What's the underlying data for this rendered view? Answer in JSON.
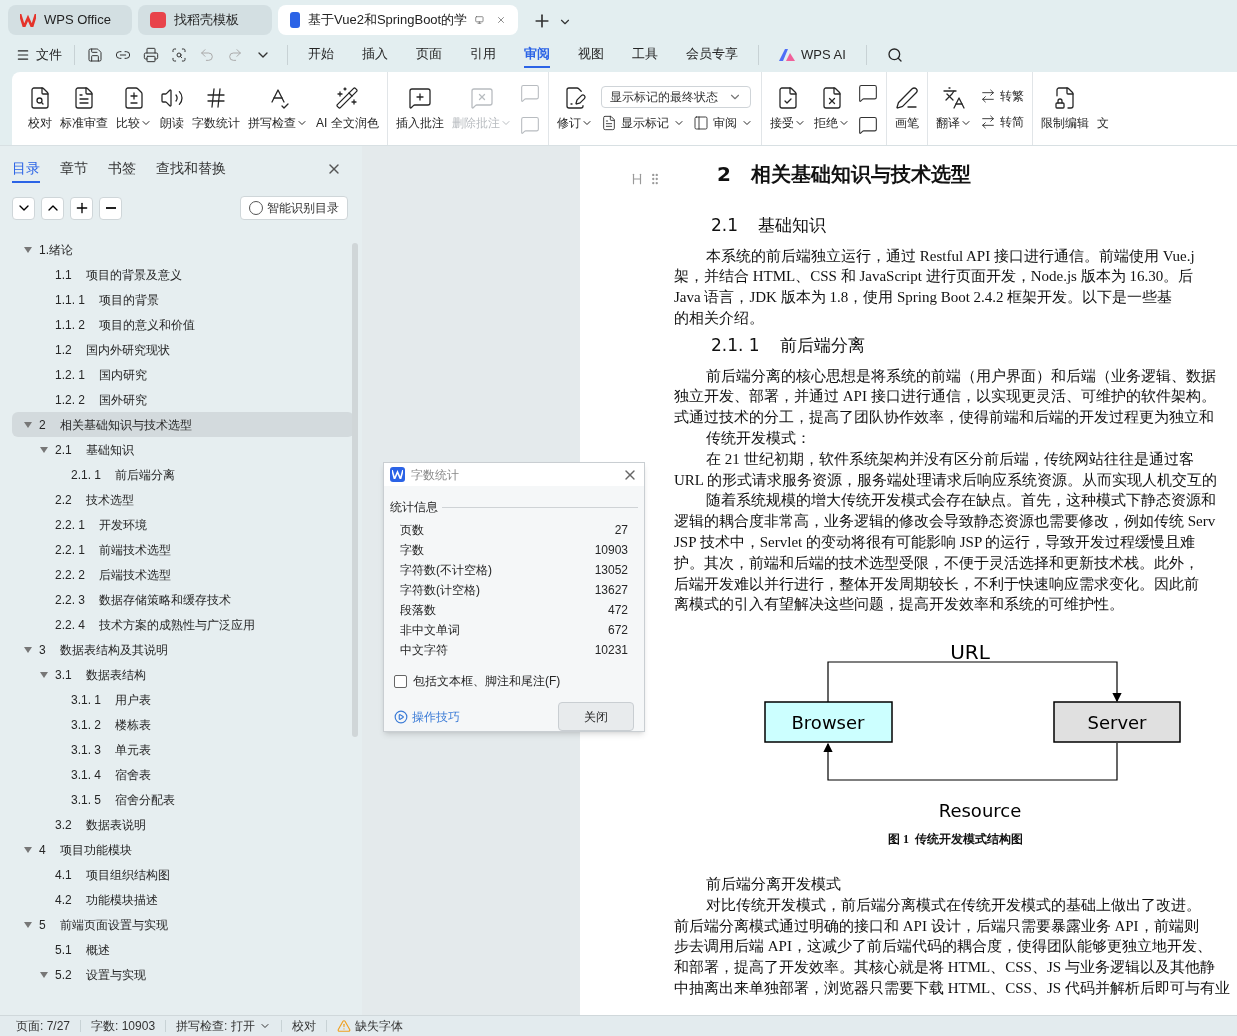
{
  "tabs": [
    {
      "label": "WPS Office",
      "selected": false
    },
    {
      "label": "找稻壳模板",
      "selected": false
    },
    {
      "label": "基于Vue2和SpringBoot的学",
      "selected": true
    }
  ],
  "menu": {
    "file": "文件",
    "tabs": [
      {
        "label": "开始",
        "selected": false
      },
      {
        "label": "插入",
        "selected": false
      },
      {
        "label": "页面",
        "selected": false
      },
      {
        "label": "引用",
        "selected": false
      },
      {
        "label": "审阅",
        "selected": true
      },
      {
        "label": "视图",
        "selected": false
      },
      {
        "label": "工具",
        "selected": false
      },
      {
        "label": "会员专享",
        "selected": false
      }
    ],
    "ai": "WPS AI"
  },
  "ribbon": [
    [
      {
        "kind": "large",
        "label": "校对",
        "caret": false,
        "disabled": false
      },
      {
        "kind": "large",
        "label": "标准审查",
        "caret": false,
        "disabled": false
      },
      {
        "kind": "large",
        "label": "比较",
        "caret": true,
        "disabled": false
      },
      {
        "kind": "large",
        "label": "朗读",
        "caret": false,
        "disabled": false
      },
      {
        "kind": "large",
        "label": "字数统计",
        "caret": false,
        "disabled": false
      },
      {
        "kind": "large",
        "label": "拼写检查",
        "caret": true,
        "disabled": false
      },
      {
        "kind": "large",
        "label": "AI 全文润色",
        "caret": false,
        "disabled": false
      }
    ],
    [
      {
        "kind": "large",
        "label": "插入批注",
        "caret": false,
        "disabled": false
      },
      {
        "kind": "large",
        "label": "删除批注",
        "caret": true,
        "disabled": true
      },
      {
        "kind": "icons",
        "disabled": true
      }
    ],
    [
      {
        "kind": "large",
        "label": "修订",
        "caret": true,
        "disabled": false
      },
      {
        "kind": "stack",
        "select": "显示标记的最终状态",
        "buttons": [
          {
            "label": "显示标记",
            "caret": true
          },
          {
            "label": "审阅",
            "caret": true
          }
        ]
      }
    ],
    [
      {
        "kind": "large",
        "label": "接受",
        "caret": true,
        "disabled": false
      },
      {
        "kind": "large",
        "label": "拒绝",
        "caret": true,
        "disabled": false
      },
      {
        "kind": "icons",
        "disabled": false
      }
    ],
    [
      {
        "kind": "large",
        "label": "画笔",
        "caret": false,
        "disabled": false
      }
    ],
    [
      {
        "kind": "large",
        "label": "翻译",
        "caret": true,
        "disabled": false
      },
      {
        "kind": "stack",
        "buttons": [
          {
            "label": "转繁",
            "caret": false
          },
          {
            "label": "转简",
            "caret": false
          }
        ]
      }
    ],
    [
      {
        "kind": "large",
        "label": "限制编辑",
        "caret": false,
        "disabled": false
      },
      {
        "kind": "large",
        "label": "文",
        "caret": false,
        "disabled": false
      }
    ]
  ],
  "nav": {
    "tabs": [
      {
        "label": "目录",
        "selected": true
      },
      {
        "label": "章节",
        "selected": false
      },
      {
        "label": "书签",
        "selected": false
      },
      {
        "label": "查找和替换",
        "selected": false
      }
    ],
    "smart_button": "智能识别目录",
    "tree": [
      {
        "title": "1.绪论",
        "expanded": true,
        "selected": false,
        "children": [
          {
            "num": "1.1",
            "title": "项目的背景及意义",
            "selected": false
          },
          {
            "num": "1.1. 1",
            "title": "项目的背景",
            "selected": false
          },
          {
            "num": "1.1. 2",
            "title": "项目的意义和价值",
            "selected": false
          },
          {
            "num": "1.2",
            "title": "国内外研究现状",
            "selected": false
          },
          {
            "num": "1.2. 1",
            "title": "国内研究",
            "selected": false
          },
          {
            "num": "1.2. 2",
            "title": "国外研究",
            "selected": false
          }
        ]
      },
      {
        "num": "2",
        "title": "相关基础知识与技术选型",
        "expanded": true,
        "selected": true,
        "children": [
          {
            "num": "2.1",
            "title": "基础知识",
            "expanded": true,
            "selected": false,
            "children": [
              {
                "num": "2.1. 1",
                "title": "前后端分离",
                "selected": false
              }
            ]
          },
          {
            "num": "2.2",
            "title": "技术选型",
            "selected": false
          },
          {
            "num": "2.2. 1",
            "title": "开发环境",
            "selected": false
          },
          {
            "num": "2.2. 1",
            "title": "前端技术选型",
            "selected": false
          },
          {
            "num": "2.2. 2",
            "title": "后端技术选型",
            "selected": false
          },
          {
            "num": "2.2. 3",
            "title": "数据存储策略和缓存技术",
            "selected": false
          },
          {
            "num": "2.2. 4",
            "title": "技术方案的成熟性与广泛应用",
            "selected": false
          }
        ]
      },
      {
        "num": "3",
        "title": "数据表结构及其说明",
        "expanded": true,
        "selected": false,
        "children": [
          {
            "num": "3.1",
            "title": "数据表结构",
            "expanded": true,
            "selected": false,
            "children": [
              {
                "num": "3.1. 1",
                "title": "用户表",
                "selected": false
              },
              {
                "num": "3.1. 2",
                "title": "楼栋表",
                "selected": false
              },
              {
                "num": "3.1. 3",
                "title": "单元表",
                "selected": false
              },
              {
                "num": "3.1. 4",
                "title": "宿舍表",
                "selected": false
              },
              {
                "num": "3.1. 5",
                "title": "宿舍分配表",
                "selected": false
              }
            ]
          },
          {
            "num": "3.2",
            "title": "数据表说明",
            "selected": false
          }
        ]
      },
      {
        "num": "4",
        "title": "项目功能模块",
        "expanded": true,
        "selected": false,
        "children": [
          {
            "num": "4.1",
            "title": "项目组织结构图",
            "selected": false
          },
          {
            "num": "4.2",
            "title": "功能模块描述",
            "selected": false
          }
        ]
      },
      {
        "num": "5",
        "title": "前端页面设置与实现",
        "expanded": true,
        "selected": false,
        "children": [
          {
            "num": "5.1",
            "title": "概述",
            "selected": false
          },
          {
            "num": "5.2",
            "title": "设置与实现",
            "expanded": true,
            "selected": false
          }
        ]
      }
    ]
  },
  "document": [
    {
      "kind": "h1",
      "num": "2",
      "text": "相关基础知识与技术选型"
    },
    {
      "kind": "h2",
      "num": "2.1",
      "text": "基础知识"
    },
    {
      "kind": "para",
      "lines": [
        "本系统的前后端独立运行，通过 Restful API 接口进行通信。前端使用 Vue.j",
        "架，并结合 HTML、CSS 和 JavaScript 进行页面开发，Node.js 版本为 16.30。后",
        "Java 语言，JDK 版本为 1.8，使用 Spring Boot 2.4.2 框架开发。以下是一些基",
        "的相关介绍。"
      ]
    },
    {
      "kind": "h2",
      "num": "2.1. 1",
      "text": "前后端分离"
    },
    {
      "kind": "para",
      "lines": [
        "前后端分离的核心思想是将系统的前端（用户界面）和后端（业务逻辑、数据",
        "独立开发、部署，并通过 API 接口进行通信，以实现更灵活、可维护的软件架构。",
        "式通过技术的分工，提高了团队协作效率，使得前端和后端的开发过程更为独立和"
      ]
    },
    {
      "kind": "para",
      "lines": [
        "传统开发模式："
      ]
    },
    {
      "kind": "para",
      "lines": [
        "在 21 世纪初期，软件系统架构并没有区分前后端，传统网站往往是通过客",
        "URL 的形式请求服务资源，服务端处理请求后响应系统资源。从而实现人机交互的"
      ]
    },
    {
      "kind": "para",
      "lines": [
        "随着系统规模的增大传统开发模式会存在缺点。首先，这种模式下静态资源和",
        "逻辑的耦合度非常高，业务逻辑的修改会导致静态资源也需要修改，例如传统 Serv",
        "JSP 技术中，Servlet 的变动将很有可能影响 JSP 的运行，导致开发过程缓慢且难",
        "护。其次，前端和后端的技术选型受限，不便于灵活选择和更新技术栈。此外，",
        "后端开发难以并行进行，整体开发周期较长，不利于快速响应需求变化。因此前",
        "离模式的引入有望解决这些问题，提高开发效率和系统的可维护性。"
      ]
    },
    {
      "kind": "figure",
      "top_label": "URL",
      "left_node": "Browser",
      "right_node": "Server",
      "bottom_label": "Resource",
      "caption": "图 1  传统开发模式结构图"
    },
    {
      "kind": "para",
      "lines": [
        "前后端分离开发模式"
      ]
    },
    {
      "kind": "para",
      "lines": [
        "对比传统开发模式，前后端分离模式在传统开发模式的基础上做出了改进。",
        "前后端分离模式通过明确的接口和 API 设计，后端只需要暴露业务 API，前端则",
        "步去调用后端 API，这减少了前后端代码的耦合度，使得团队能够更独立地开发、",
        "和部署，提高了开发效率。其核心就是将 HTML、CSS、JS 与业务逻辑以及其他静",
        "中抽离出来单独部署，浏览器只需要下载 HTML、CSS、JS 代码并解析后即可与有业"
      ]
    }
  ],
  "dialog": {
    "title": "字数统计",
    "section": "统计信息",
    "rows": [
      {
        "label": "页数",
        "value": "27"
      },
      {
        "label": "字数",
        "value": "10903"
      },
      {
        "label": "字符数(不计空格)",
        "value": "13052"
      },
      {
        "label": "字符数(计空格)",
        "value": "13627"
      },
      {
        "label": "段落数",
        "value": "472"
      },
      {
        "label": "非中文单词",
        "value": "672"
      },
      {
        "label": "中文字符",
        "value": "10231"
      }
    ],
    "checkbox": {
      "label": "包括文本框、脚注和尾注(F)",
      "checked": false
    },
    "tips_link": "操作技巧",
    "close_button": "关闭"
  },
  "status_bar": [
    "页面: 7/27",
    "字数: 10903",
    "拼写检查: 打开",
    "校对",
    "缺失字体"
  ]
}
